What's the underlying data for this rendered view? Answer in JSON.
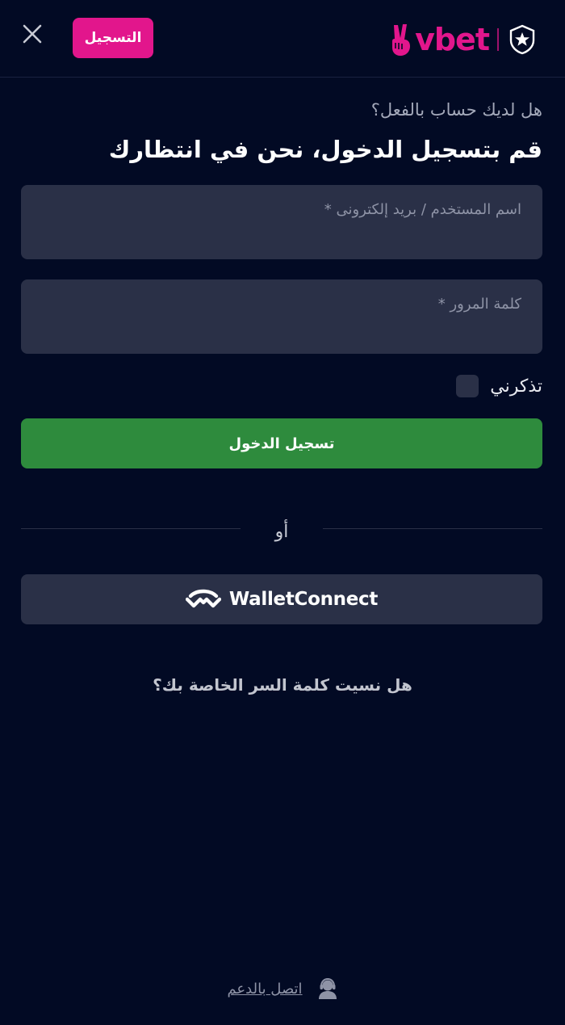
{
  "header": {
    "register_label": "التسجيل",
    "brand_name": "vbet",
    "close_icon": "close-icon",
    "club_badge_icon": "star-shield-icon"
  },
  "login": {
    "subtitle": "هل لديك حساب بالفعل؟",
    "title": "قم بتسجيل الدخول، نحن في انتظارك",
    "username_label": "اسم المستخدم / بريد إلكترونى *",
    "username_value": "",
    "password_label": "كلمة المرور *",
    "password_value": "",
    "remember_label": "تذكرني",
    "remember_checked": false,
    "submit_label": "تسجيل الدخول",
    "or_label": "أو",
    "wallet_label": "WalletConnect",
    "forgot_label": "هل نسيت كلمة السر الخاصة بك؟"
  },
  "footer": {
    "support_label": "اتصل بالدعم",
    "support_icon": "support-agent-icon"
  },
  "colors": {
    "background": "#020a24",
    "brand": "#e2168c",
    "surface": "#2a3047",
    "success": "#2e8b3d"
  }
}
